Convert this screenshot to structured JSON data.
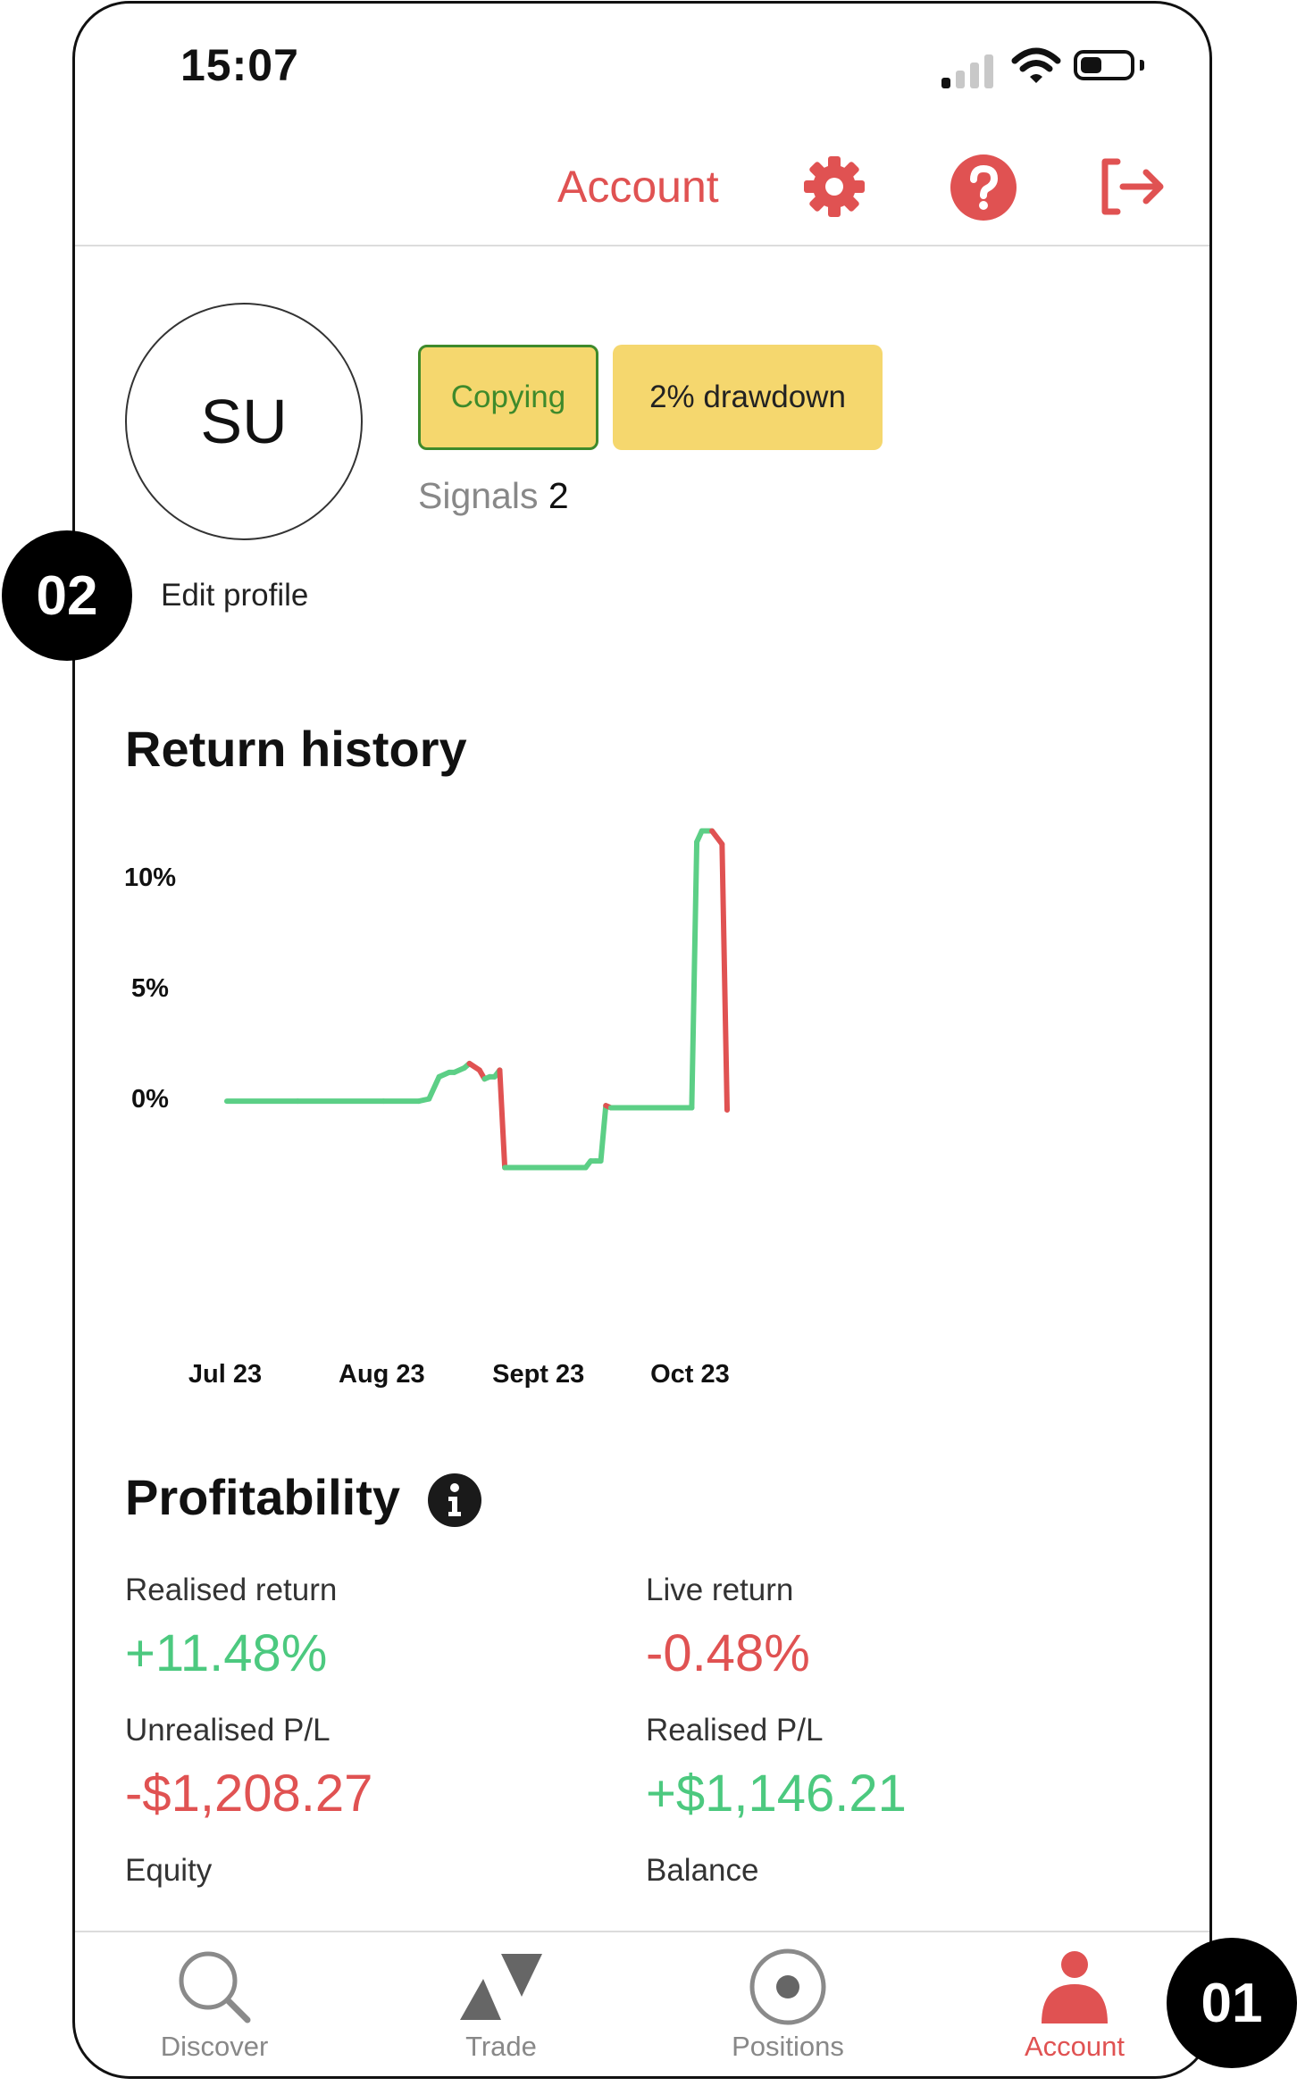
{
  "status_bar": {
    "time": "15:07",
    "signal_icon": "signal-bars-icon",
    "wifi_icon": "wifi-icon",
    "battery_icon": "battery-icon",
    "battery_level": 0.45
  },
  "header": {
    "title": "Account",
    "settings_icon": "gear-icon",
    "help_icon": "help-icon",
    "logout_icon": "logout-icon"
  },
  "profile": {
    "initials": "SU",
    "edit_label": "Edit profile",
    "badges": {
      "copying": "Copying",
      "drawdown": "2% drawdown"
    },
    "signals_label": "Signals",
    "signals_count": "2"
  },
  "return_history": {
    "title": "Return history"
  },
  "chart_data": {
    "type": "line",
    "title": "",
    "x_ticks": [
      "Jul 23",
      "Aug 23",
      "Sept 23",
      "Oct 23"
    ],
    "y_ticks": [
      "0%",
      "5%",
      "10%"
    ],
    "ylim": [
      -3.3,
      12.1
    ],
    "series": [
      {
        "color_up": "#5ccf86",
        "color_down": "#e05252",
        "points": [
          [
            "Jul 1",
            -0.2
          ],
          [
            "Jul 15",
            -0.2
          ],
          [
            "Aug 1",
            -0.2
          ],
          [
            "Aug 8",
            -0.2
          ],
          [
            "Aug 10",
            -0.1
          ],
          [
            "Aug 12",
            0.9
          ],
          [
            "Aug 14",
            1.1
          ],
          [
            "Aug 15",
            1.1
          ],
          [
            "Aug 17",
            1.3
          ],
          [
            "Aug 18",
            1.5
          ],
          [
            "Aug 20",
            1.2
          ],
          [
            "Aug 21",
            0.8
          ],
          [
            "Aug 22",
            0.9
          ],
          [
            "Aug 23",
            0.9
          ],
          [
            "Aug 24",
            1.2
          ],
          [
            "Aug 25",
            -3.2
          ],
          [
            "Sep 10",
            -3.2
          ],
          [
            "Sep 11",
            -2.9
          ],
          [
            "Sep 12",
            -2.9
          ],
          [
            "Sep 13",
            -2.9
          ],
          [
            "Sep 14",
            -0.4
          ],
          [
            "Sep 15",
            -0.5
          ],
          [
            "Sep 20",
            -0.5
          ],
          [
            "Sep 25",
            -0.5
          ],
          [
            "Sep 28",
            -0.5
          ],
          [
            "Oct 1",
            -0.5
          ],
          [
            "Oct 2",
            11.5
          ],
          [
            "Oct 3",
            12.0
          ],
          [
            "Oct 4",
            12.0
          ],
          [
            "Oct 5",
            12.0
          ],
          [
            "Oct 7",
            11.4
          ],
          [
            "Oct 8",
            -0.6
          ]
        ]
      }
    ]
  },
  "profitability": {
    "title": "Profitability",
    "info_icon": "info-icon",
    "realised_return": {
      "label": "Realised return",
      "value": "+11.48%"
    },
    "live_return": {
      "label": "Live return",
      "value": "-0.48%"
    },
    "unrealised_pl": {
      "label": "Unrealised P/L",
      "value": "-$1,208.27"
    },
    "realised_pl": {
      "label": "Realised P/L",
      "value": "+$1,146.21"
    },
    "equity": {
      "label": "Equity"
    },
    "balance": {
      "label": "Balance"
    }
  },
  "nav": {
    "items": [
      {
        "label": "Discover",
        "icon": "search-icon"
      },
      {
        "label": "Trade",
        "icon": "trade-icon"
      },
      {
        "label": "Positions",
        "icon": "positions-icon"
      },
      {
        "label": "Account",
        "icon": "user-icon"
      }
    ]
  },
  "annotations": {
    "step_1": "01",
    "step_2": "02"
  },
  "colors": {
    "accent": "#e05252",
    "positive": "#4cc97f",
    "badge": "#f5d76e",
    "badge_border": "#3e8a2b"
  }
}
